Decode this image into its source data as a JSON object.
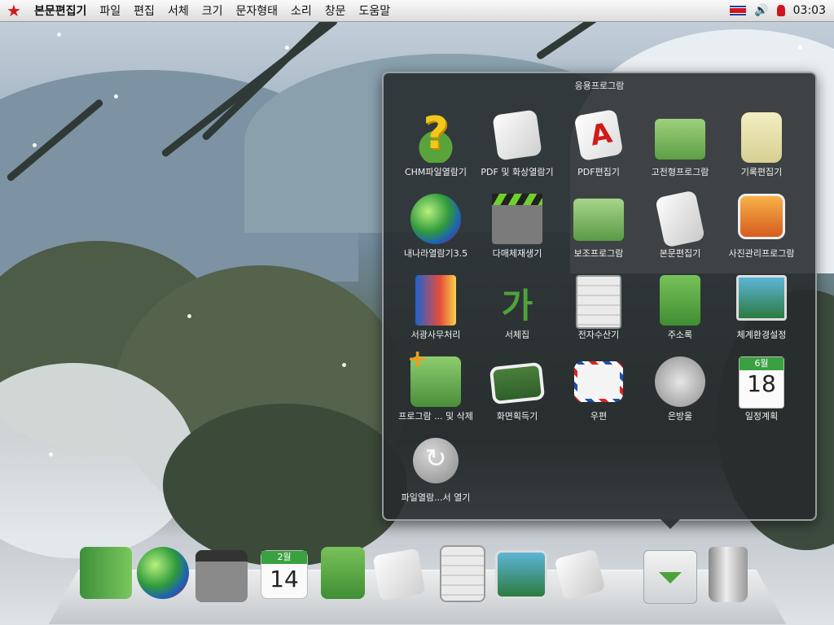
{
  "menubar": {
    "items": [
      "본문편집기",
      "파일",
      "편집",
      "서체",
      "크기",
      "문자형태",
      "소리",
      "창문",
      "도움말"
    ],
    "clock": "03:03"
  },
  "launcher": {
    "title": "응용프로그람",
    "apps": [
      {
        "label": "CHM파일열람기",
        "icon": "help-icon"
      },
      {
        "label": "PDF 및 화상열람기",
        "icon": "document-viewer-icon"
      },
      {
        "label": "PDF편집기",
        "icon": "pdf-editor-icon"
      },
      {
        "label": "고전형프로그람",
        "icon": "folder-icon"
      },
      {
        "label": "기록편집기",
        "icon": "notepad-icon"
      },
      {
        "label": "내나라열람기3.5",
        "icon": "globe-icon"
      },
      {
        "label": "다매체재생기",
        "icon": "film-clapper-icon"
      },
      {
        "label": "보조프로그람",
        "icon": "tools-folder-icon"
      },
      {
        "label": "본문편집기",
        "icon": "text-editor-icon"
      },
      {
        "label": "사진관리프로그람",
        "icon": "photo-manager-icon"
      },
      {
        "label": "서광사무처리",
        "icon": "office-suite-icon"
      },
      {
        "label": "서체집",
        "icon": "font-icon"
      },
      {
        "label": "전자수산기",
        "icon": "calculator-icon"
      },
      {
        "label": "주소록",
        "icon": "address-book-icon"
      },
      {
        "label": "체계환경설정",
        "icon": "system-settings-icon"
      },
      {
        "label": "프로그람 ... 및 삭제",
        "icon": "program-install-icon"
      },
      {
        "label": "화면획득기",
        "icon": "screenshot-icon"
      },
      {
        "label": "우편",
        "icon": "mail-icon"
      },
      {
        "label": "은방울",
        "icon": "emblem-icon"
      },
      {
        "label": "일정계획",
        "icon": "calendar-icon"
      },
      {
        "label": "파일열람...서 열기",
        "icon": "open-with-icon"
      }
    ],
    "calendar_icon": {
      "month": "6월",
      "day": "18"
    }
  },
  "dock": {
    "calendar_icon": {
      "month": "2월",
      "day": "14"
    },
    "items": [
      "office-suite-icon",
      "globe-icon",
      "film-clapper-icon",
      "calendar-icon",
      "address-book-icon",
      "document-viewer-icon",
      "calculator-icon",
      "system-settings-icon",
      "text-editor-icon",
      "launcher-toggle-icon",
      "trash-icon"
    ]
  }
}
